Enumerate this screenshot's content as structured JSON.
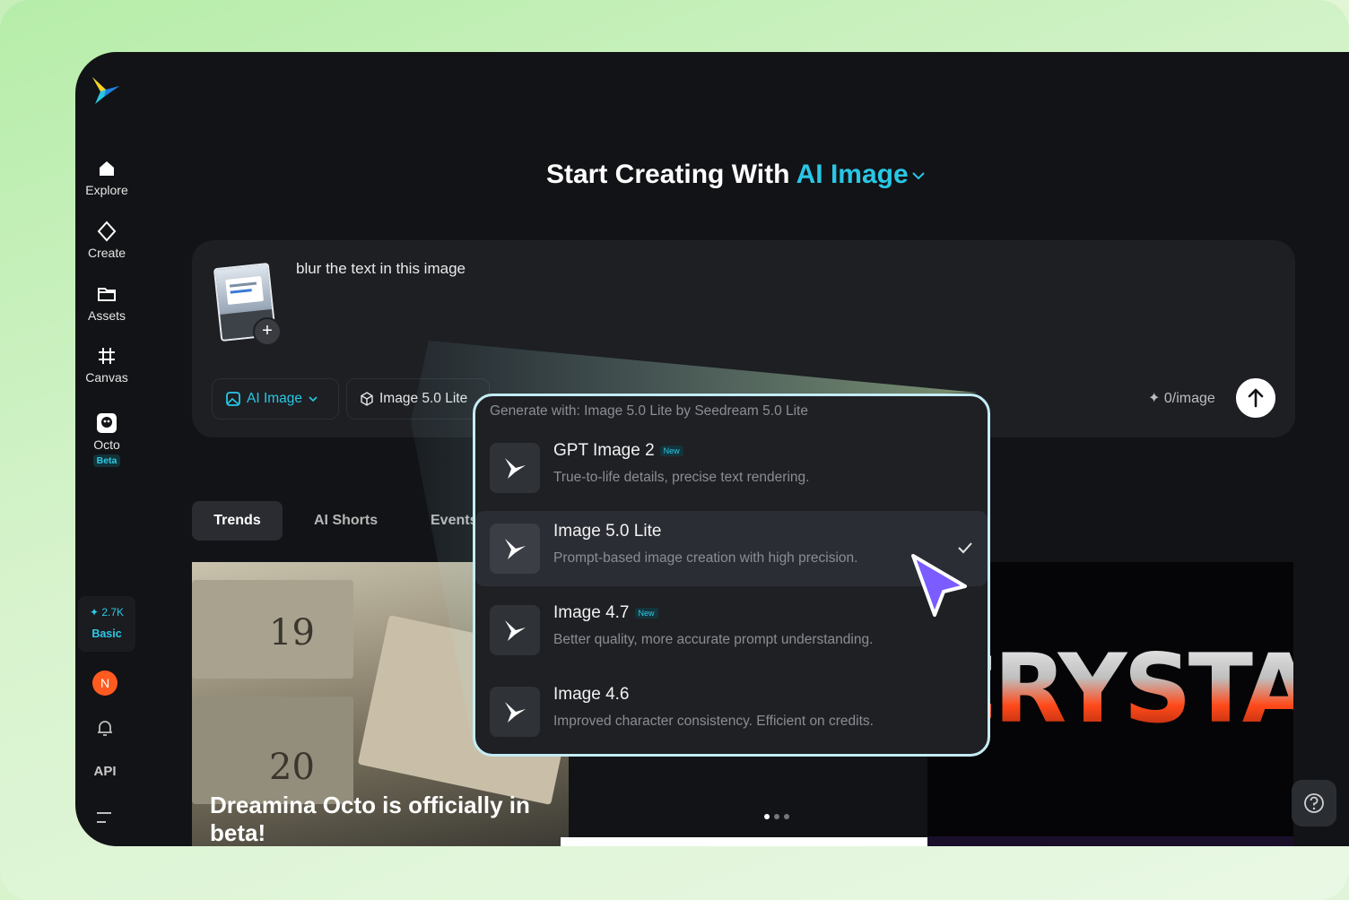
{
  "sidebar": {
    "items": [
      {
        "label": "Explore",
        "icon": "home-icon"
      },
      {
        "label": "Create",
        "icon": "sparkle-diamond-icon"
      },
      {
        "label": "Assets",
        "icon": "folder-icon"
      },
      {
        "label": "Canvas",
        "icon": "frame-grid-icon"
      },
      {
        "label": "Octo",
        "icon": "octo-icon",
        "badge": "Beta"
      }
    ],
    "credits": {
      "amount": "2.7K",
      "plan": "Basic"
    },
    "avatar_initial": "N",
    "api_label": "API"
  },
  "heading": {
    "prefix": "Start Creating With ",
    "accent": "AI Image"
  },
  "prompt": {
    "text": "blur the text in this image",
    "mode_label": "AI Image",
    "model_label": "Image 5.0 Lite",
    "cost_label": "0/image"
  },
  "tabs": [
    {
      "label": "Trends",
      "active": true
    },
    {
      "label": "AI Shorts",
      "active": false
    },
    {
      "label": "Events",
      "active": false
    }
  ],
  "banners": {
    "main_title": "Dreamina Octo is officially in beta!",
    "box_numbers": [
      "19",
      "20"
    ],
    "side_text": "CRYSTAL"
  },
  "dropdown": {
    "title": "Generate with: Image 5.0 Lite by Seedream 5.0 Lite",
    "options": [
      {
        "name": "GPT Image 2",
        "badge": "New",
        "desc": "True-to-life details, precise text rendering.",
        "selected": false
      },
      {
        "name": "Image 5.0 Lite",
        "badge": "",
        "desc": "Prompt-based image creation with high precision.",
        "selected": true
      },
      {
        "name": "Image 4.7",
        "badge": "New",
        "desc": "Better quality, more accurate prompt understanding.",
        "selected": false
      },
      {
        "name": "Image 4.6",
        "badge": "",
        "desc": "Improved character consistency. Efficient on credits.",
        "selected": false
      }
    ]
  },
  "colors": {
    "accent": "#29c7e6",
    "background": "#121316",
    "panel": "#1d1f23",
    "cursor": "#7b5cff"
  }
}
